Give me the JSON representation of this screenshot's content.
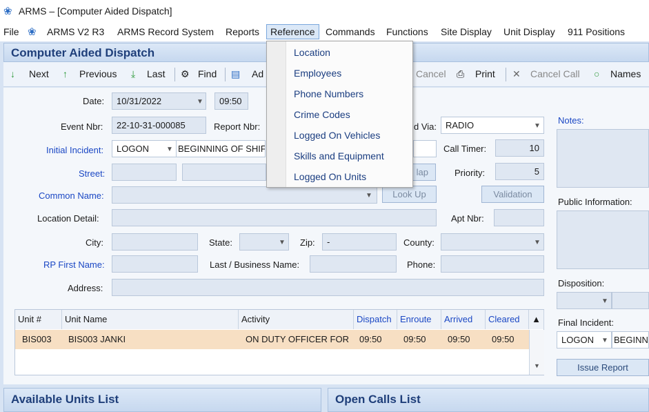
{
  "window": {
    "title": "ARMS – [Computer Aided Dispatch]",
    "icon": "arms-logo-icon"
  },
  "menubar": {
    "file": "File",
    "arms_v2": "ARMS V2 R3",
    "arms_record": "ARMS Record System",
    "reports": "Reports",
    "reference": "Reference",
    "commands": "Commands",
    "functions": "Functions",
    "site_display": "Site Display",
    "unit_display": "Unit Display",
    "positions_911": "911 Positions"
  },
  "reference_menu": {
    "items": [
      "Location",
      "Employees",
      "Phone Numbers",
      "Crime Codes",
      "Logged On Vehicles",
      "Skills and Equipment",
      "Logged On Units"
    ]
  },
  "cad": {
    "title": "Computer Aided Dispatch"
  },
  "toolbar": {
    "next": "Next",
    "previous": "Previous",
    "last": "Last",
    "find": "Find",
    "add": "Ad",
    "cancel": "Cancel",
    "print": "Print",
    "cancel_call": "Cancel Call",
    "names": "Names"
  },
  "form": {
    "date_label": "Date:",
    "date_value": "10/31/2022",
    "time_value": "09:50",
    "event_nbr_label": "Event Nbr:",
    "event_nbr_value": "22-10-31-000085",
    "report_nbr_label": "Report Nbr:",
    "recd_via_label": "d Via:",
    "recd_via_value": "RADIO",
    "initial_incident_label": "Initial Incident:",
    "initial_incident_code": "LOGON",
    "initial_incident_desc": "BEGINNING OF SHIFT",
    "call_timer_label": "Call Timer:",
    "call_timer_value": "10",
    "street_label": "Street:",
    "map_button": "lap",
    "priority_label": "Priority:",
    "priority_value": "5",
    "common_name_label": "Common Name:",
    "lookup_button": "Look Up",
    "validation_button": "Validation",
    "location_detail_label": "Location Detail:",
    "apt_nbr_label": "Apt Nbr:",
    "city_label": "City:",
    "state_label": "State:",
    "zip_label": "Zip:",
    "zip_value": "-",
    "county_label": "County:",
    "rp_first_label": "RP First Name:",
    "last_business_label": "Last / Business Name:",
    "phone_label": "Phone:",
    "address_label": "Address:"
  },
  "right_panel": {
    "notes_label": "Notes:",
    "public_info_label": "Public  Information:",
    "disposition_label": "Disposition:",
    "final_incident_label": "Final Incident:",
    "final_incident_code": "LOGON",
    "final_incident_desc": "BEGINNI",
    "issue_report_button": "Issue Report"
  },
  "unit_table": {
    "headers": [
      "Unit #",
      "Unit Name",
      "Activity",
      "Dispatch",
      "Enroute",
      "Arrived",
      "Cleared"
    ],
    "rows": [
      [
        "BIS003",
        "BIS003 JANKI",
        "ON DUTY OFFICER FOR",
        "09:50",
        "09:50",
        "09:50",
        "09:50"
      ]
    ]
  },
  "bottom": {
    "available_units_title": "Available Units List",
    "open_calls_title": "Open Calls List"
  },
  "colors": {
    "accent": "#1f3f7a",
    "selected_row": "#f7dfc3",
    "label_blue": "#1a47c4"
  }
}
